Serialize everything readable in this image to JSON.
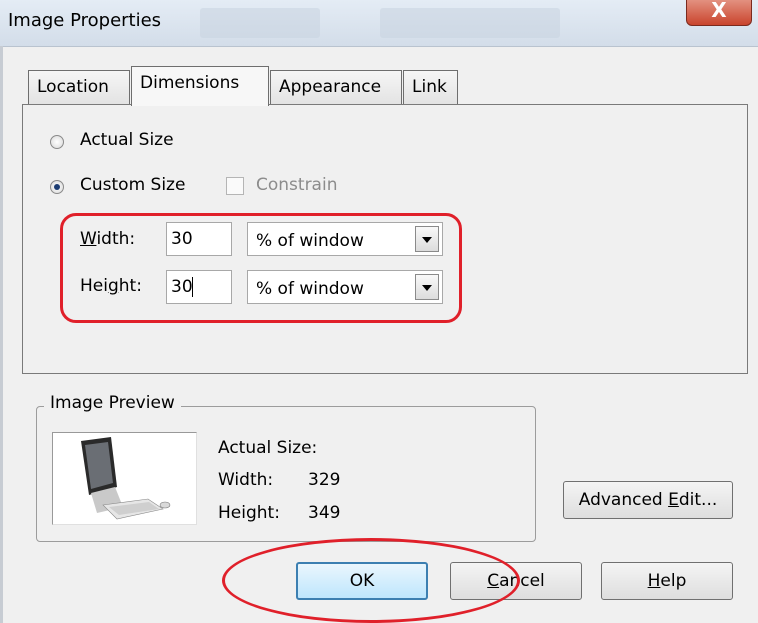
{
  "window": {
    "title": "Image Properties",
    "close_glyph": "X"
  },
  "tabs": [
    {
      "label": "Location",
      "active": false
    },
    {
      "label": "Dimensions",
      "active": true
    },
    {
      "label": "Appearance",
      "active": false
    },
    {
      "label": "Link",
      "active": false
    }
  ],
  "dimensions": {
    "actual_size_label": "Actual Size",
    "custom_size_label": "Custom Size",
    "selected": "Custom Size",
    "constrain_label": "Constrain",
    "constrain_checked": false,
    "width_label_before": "",
    "width_label_mnemonic": "W",
    "width_label_after": "idth:",
    "width_value": "30",
    "width_unit": "% of window",
    "height_label_before": "Hei",
    "height_label_mnemonic": "g",
    "height_label_after": "ht:",
    "height_value": "30",
    "height_unit": "% of window"
  },
  "preview": {
    "legend": "Image Preview",
    "icon": "monitor-computer-icon",
    "actual_size_label": "Actual Size:",
    "width_label": "Width:",
    "width_value": "329",
    "height_label": "Height:",
    "height_value": "349"
  },
  "buttons": {
    "advanced_edit_before": "Advanced ",
    "advanced_edit_mnemonic": "E",
    "advanced_edit_after": "dit...",
    "ok": "OK",
    "cancel_mnemonic": "C",
    "cancel_after": "ancel",
    "help_mnemonic": "H",
    "help_after": "elp"
  },
  "annotations": {
    "color": "#e0202a"
  }
}
